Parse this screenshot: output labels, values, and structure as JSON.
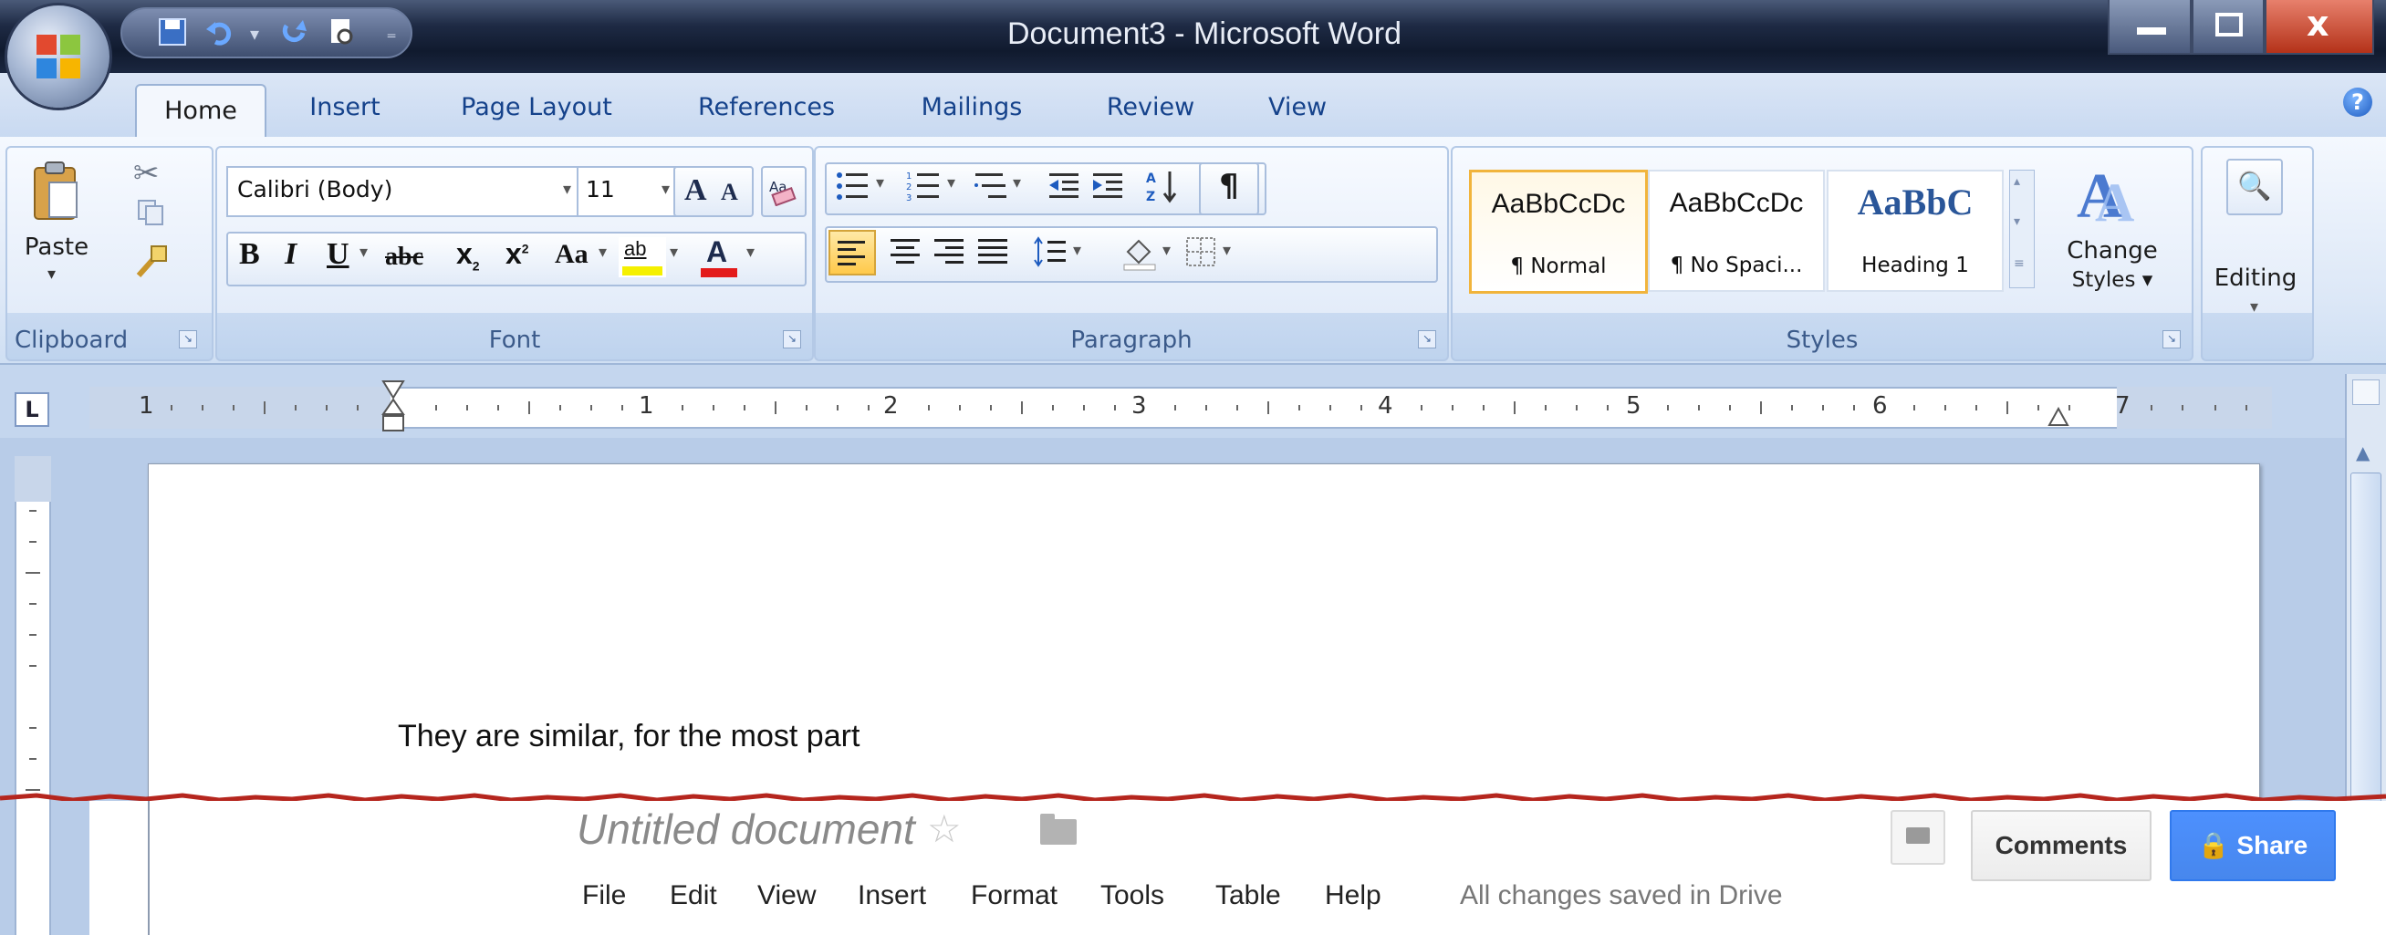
{
  "window": {
    "title": "Document3 - Microsoft Word",
    "minimize_icon": "minimize-icon",
    "maximize_icon": "maximize-icon",
    "close_icon": "close-icon"
  },
  "ribbon_tabs": [
    "Home",
    "Insert",
    "Page Layout",
    "References",
    "Mailings",
    "Review",
    "View"
  ],
  "clipboard": {
    "paste_label": "Paste",
    "group_label": "Clipboard"
  },
  "font": {
    "font_name": "Calibri (Body)",
    "font_size": "11",
    "grow_label": "A",
    "shrink_label": "A",
    "bold": "B",
    "italic": "I",
    "underline": "U",
    "strike": "abc",
    "subscript": "x",
    "superscript": "x",
    "change_case": "Aa",
    "highlight": "ab",
    "font_color": "A",
    "group_label": "Font"
  },
  "paragraph": {
    "group_label": "Paragraph"
  },
  "styles": {
    "tiles": [
      {
        "sample": "AaBbCcDc",
        "name": "¶ Normal"
      },
      {
        "sample": "AaBbCcDc",
        "name": "¶ No Spaci..."
      },
      {
        "sample": "AaBbC",
        "name": "Heading 1"
      }
    ],
    "change_styles_line1": "Change",
    "change_styles_line2": "Styles",
    "group_label": "Styles"
  },
  "editing": {
    "label": "Editing"
  },
  "ruler": {
    "corner": "L",
    "numbers": [
      "1",
      "1",
      "2",
      "3",
      "4",
      "5",
      "6",
      "7"
    ]
  },
  "document": {
    "body_text": "They are similar,  for the most part"
  },
  "google_docs": {
    "title": "Untitled document",
    "menu": [
      "File",
      "Edit",
      "View",
      "Insert",
      "Format",
      "Tools",
      "Table",
      "Help"
    ],
    "saved_status": "All changes saved in Drive",
    "comments_label": "Comments",
    "share_label": "Share"
  }
}
